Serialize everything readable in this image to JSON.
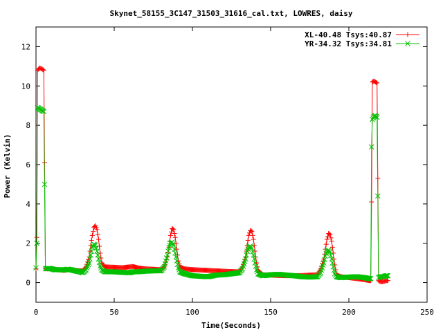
{
  "chart_data": {
    "type": "line",
    "title": "Skynet_58155_3C147_31503_31616_cal.txt, LOWRES, daisy",
    "xlabel": "Time(Seconds)",
    "ylabel": "Power (Kelvin)",
    "xlim": [
      0,
      250
    ],
    "ylim": [
      -1,
      13
    ],
    "x_ticks": [
      0,
      50,
      100,
      150,
      200,
      250
    ],
    "y_ticks": [
      0,
      2,
      4,
      6,
      8,
      10,
      12
    ],
    "x_tick_labels": [
      "0",
      "50",
      "100",
      "150",
      "200",
      "250"
    ],
    "y_tick_labels": [
      "0",
      "2",
      "4",
      "6",
      "8",
      "10",
      "12"
    ],
    "grid": false,
    "legend_position": "top-right",
    "series": [
      {
        "name": "XL-40.48 Tsys:40.87",
        "color": "#ff0000",
        "marker": "plus",
        "points": [
          [
            0,
            0.7
          ],
          [
            0.5,
            2.3
          ],
          [
            1,
            10.8
          ],
          [
            2,
            10.9
          ],
          [
            3,
            10.9
          ],
          [
            4,
            10.85
          ],
          [
            5,
            10.8
          ],
          [
            5.5,
            6.1
          ],
          [
            6,
            0.7
          ],
          [
            8,
            0.7
          ],
          [
            10,
            0.72
          ],
          [
            12,
            0.68
          ],
          [
            15,
            0.65
          ],
          [
            18,
            0.62
          ],
          [
            20,
            0.65
          ],
          [
            22,
            0.65
          ],
          [
            25,
            0.62
          ],
          [
            28,
            0.6
          ],
          [
            30,
            0.6
          ],
          [
            32,
            0.8
          ],
          [
            34,
            1.3
          ],
          [
            35,
            1.9
          ],
          [
            36,
            2.4
          ],
          [
            37,
            2.8
          ],
          [
            38,
            2.9
          ],
          [
            39,
            2.7
          ],
          [
            40,
            2.2
          ],
          [
            41,
            1.5
          ],
          [
            42,
            1.0
          ],
          [
            44,
            0.8
          ],
          [
            50,
            0.78
          ],
          [
            55,
            0.76
          ],
          [
            60,
            0.8
          ],
          [
            62,
            0.82
          ],
          [
            65,
            0.75
          ],
          [
            70,
            0.7
          ],
          [
            75,
            0.68
          ],
          [
            80,
            0.66
          ],
          [
            82,
            0.8
          ],
          [
            84,
            1.3
          ],
          [
            85,
            1.8
          ],
          [
            86,
            2.4
          ],
          [
            87,
            2.75
          ],
          [
            88,
            2.7
          ],
          [
            89,
            2.3
          ],
          [
            90,
            1.7
          ],
          [
            91,
            1.1
          ],
          [
            92,
            0.8
          ],
          [
            95,
            0.7
          ],
          [
            100,
            0.66
          ],
          [
            105,
            0.64
          ],
          [
            110,
            0.62
          ],
          [
            115,
            0.6
          ],
          [
            120,
            0.58
          ],
          [
            125,
            0.56
          ],
          [
            130,
            0.55
          ],
          [
            132,
            0.8
          ],
          [
            134,
            1.3
          ],
          [
            135,
            1.9
          ],
          [
            136,
            2.4
          ],
          [
            137,
            2.65
          ],
          [
            138,
            2.6
          ],
          [
            139,
            2.2
          ],
          [
            140,
            1.6
          ],
          [
            141,
            1.0
          ],
          [
            142,
            0.6
          ],
          [
            145,
            0.4
          ],
          [
            150,
            0.38
          ],
          [
            155,
            0.36
          ],
          [
            160,
            0.35
          ],
          [
            165,
            0.35
          ],
          [
            170,
            0.36
          ],
          [
            175,
            0.38
          ],
          [
            180,
            0.4
          ],
          [
            182,
            0.7
          ],
          [
            184,
            1.2
          ],
          [
            185,
            1.7
          ],
          [
            186,
            2.2
          ],
          [
            187,
            2.5
          ],
          [
            188,
            2.45
          ],
          [
            189,
            2.1
          ],
          [
            190,
            1.5
          ],
          [
            191,
            0.9
          ],
          [
            192,
            0.4
          ],
          [
            195,
            0.3
          ],
          [
            200,
            0.25
          ],
          [
            205,
            0.2
          ],
          [
            210,
            0.15
          ],
          [
            213,
            0.1
          ],
          [
            214,
            0.1
          ],
          [
            214.5,
            4.1
          ],
          [
            215,
            10.2
          ],
          [
            216,
            10.25
          ],
          [
            217,
            10.2
          ],
          [
            218,
            10.15
          ],
          [
            218.5,
            5.3
          ],
          [
            219,
            0.1
          ],
          [
            220,
            0.05
          ],
          [
            222,
            0.05
          ],
          [
            224,
            0.1
          ],
          [
            225,
            0.1
          ]
        ]
      },
      {
        "name": "YR-34.32 Tsys:34.81",
        "color": "#00c000",
        "marker": "cross",
        "points": [
          [
            0,
            0.75
          ],
          [
            0.5,
            2.0
          ],
          [
            1,
            8.9
          ],
          [
            2,
            8.85
          ],
          [
            3,
            8.8
          ],
          [
            4,
            8.75
          ],
          [
            5,
            8.7
          ],
          [
            5.5,
            5.0
          ],
          [
            6,
            0.7
          ],
          [
            8,
            0.72
          ],
          [
            10,
            0.7
          ],
          [
            12,
            0.65
          ],
          [
            15,
            0.66
          ],
          [
            18,
            0.64
          ],
          [
            20,
            0.68
          ],
          [
            22,
            0.66
          ],
          [
            25,
            0.6
          ],
          [
            28,
            0.55
          ],
          [
            30,
            0.5
          ],
          [
            32,
            0.65
          ],
          [
            34,
            1.0
          ],
          [
            35,
            1.4
          ],
          [
            36,
            1.8
          ],
          [
            37,
            1.95
          ],
          [
            38,
            1.9
          ],
          [
            39,
            1.6
          ],
          [
            40,
            1.2
          ],
          [
            41,
            0.85
          ],
          [
            42,
            0.65
          ],
          [
            44,
            0.55
          ],
          [
            50,
            0.55
          ],
          [
            55,
            0.52
          ],
          [
            60,
            0.5
          ],
          [
            62,
            0.55
          ],
          [
            65,
            0.55
          ],
          [
            70,
            0.58
          ],
          [
            75,
            0.6
          ],
          [
            80,
            0.6
          ],
          [
            82,
            0.8
          ],
          [
            84,
            1.4
          ],
          [
            85,
            1.8
          ],
          [
            86,
            2.0
          ],
          [
            87,
            2.05
          ],
          [
            88,
            1.9
          ],
          [
            89,
            1.5
          ],
          [
            90,
            1.1
          ],
          [
            91,
            0.75
          ],
          [
            92,
            0.55
          ],
          [
            95,
            0.45
          ],
          [
            100,
            0.35
          ],
          [
            105,
            0.32
          ],
          [
            110,
            0.3
          ],
          [
            115,
            0.38
          ],
          [
            120,
            0.4
          ],
          [
            125,
            0.45
          ],
          [
            130,
            0.5
          ],
          [
            132,
            0.7
          ],
          [
            134,
            1.2
          ],
          [
            135,
            1.6
          ],
          [
            136,
            1.8
          ],
          [
            137,
            1.85
          ],
          [
            138,
            1.75
          ],
          [
            139,
            1.4
          ],
          [
            140,
            1.0
          ],
          [
            141,
            0.65
          ],
          [
            142,
            0.45
          ],
          [
            145,
            0.35
          ],
          [
            150,
            0.4
          ],
          [
            155,
            0.42
          ],
          [
            160,
            0.38
          ],
          [
            165,
            0.35
          ],
          [
            170,
            0.3
          ],
          [
            175,
            0.28
          ],
          [
            180,
            0.3
          ],
          [
            182,
            0.5
          ],
          [
            184,
            1.0
          ],
          [
            185,
            1.35
          ],
          [
            186,
            1.6
          ],
          [
            187,
            1.65
          ],
          [
            188,
            1.55
          ],
          [
            189,
            1.2
          ],
          [
            190,
            0.8
          ],
          [
            191,
            0.45
          ],
          [
            192,
            0.3
          ],
          [
            195,
            0.25
          ],
          [
            200,
            0.28
          ],
          [
            205,
            0.3
          ],
          [
            210,
            0.25
          ],
          [
            213,
            0.2
          ],
          [
            214,
            0.2
          ],
          [
            214.5,
            6.9
          ],
          [
            215,
            8.3
          ],
          [
            216,
            8.45
          ],
          [
            217,
            8.5
          ],
          [
            218,
            8.4
          ],
          [
            218.5,
            4.4
          ],
          [
            219,
            0.25
          ],
          [
            220,
            0.3
          ],
          [
            222,
            0.3
          ],
          [
            224,
            0.35
          ],
          [
            225,
            0.35
          ]
        ]
      }
    ]
  }
}
